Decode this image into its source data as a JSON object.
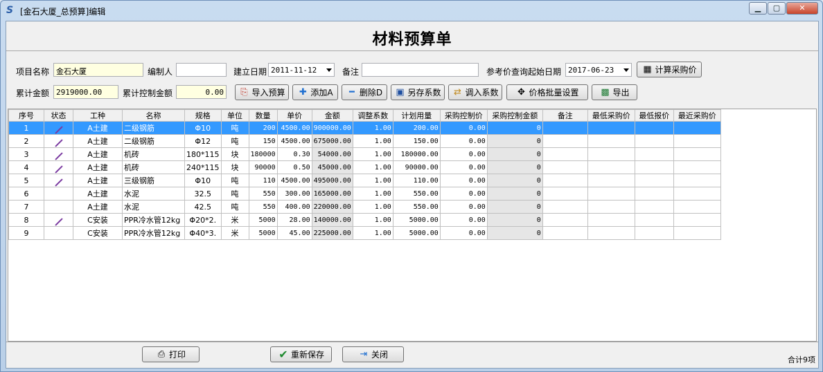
{
  "window": {
    "title": "[金石大厦_总预算]编辑"
  },
  "page_title": "材料预算单",
  "form": {
    "project_name_label": "项目名称",
    "project_name": "金石大厦",
    "editor_label": "编制人",
    "editor": "",
    "date_label": "建立日期",
    "date": "2011-11-12",
    "remark_label": "备注",
    "remark": "",
    "ref_date_label": "参考价查询起始日期",
    "ref_date": "2017-06-23",
    "calc_button": "计算采购价",
    "total_amount_label": "累计金额",
    "total_amount": "2919000.00",
    "control_amount_label": "累计控制金额",
    "control_amount": "0.00"
  },
  "toolbar": {
    "import": "导入预算",
    "add": "添加A",
    "delete": "删除D",
    "save_coef": "另存系数",
    "load_coef": "调入系数",
    "batch_price": "价格批量设置",
    "export": "导出"
  },
  "table": {
    "headers": [
      "序号",
      "状态",
      "工种",
      "名称",
      "规格",
      "单位",
      "数量",
      "单价",
      "金额",
      "调整系数",
      "计划用量",
      "采购控制价",
      "采购控制金额",
      "备注",
      "最低采购价",
      "最低报价",
      "最近采购价"
    ],
    "rows": [
      {
        "no": "1",
        "status": true,
        "type": "A土建",
        "name": "二级钢筋",
        "spec": "Φ10",
        "unit": "吨",
        "qty": "200",
        "price": "4500.00",
        "amount": "900000.00",
        "coef": "1.00",
        "plan": "200.00",
        "ctrl_price": "0.00",
        "ctrl_amount": "0"
      },
      {
        "no": "2",
        "status": true,
        "type": "A土建",
        "name": "二级钢筋",
        "spec": "Φ12",
        "unit": "吨",
        "qty": "150",
        "price": "4500.00",
        "amount": "675000.00",
        "coef": "1.00",
        "plan": "150.00",
        "ctrl_price": "0.00",
        "ctrl_amount": "0"
      },
      {
        "no": "3",
        "status": true,
        "type": "A土建",
        "name": "机砖",
        "spec": "180*115",
        "unit": "块",
        "qty": "180000",
        "price": "0.30",
        "amount": "54000.00",
        "coef": "1.00",
        "plan": "180000.00",
        "ctrl_price": "0.00",
        "ctrl_amount": "0"
      },
      {
        "no": "4",
        "status": true,
        "type": "A土建",
        "name": "机砖",
        "spec": "240*115",
        "unit": "块",
        "qty": "90000",
        "price": "0.50",
        "amount": "45000.00",
        "coef": "1.00",
        "plan": "90000.00",
        "ctrl_price": "0.00",
        "ctrl_amount": "0"
      },
      {
        "no": "5",
        "status": true,
        "type": "A土建",
        "name": "三级钢筋",
        "spec": "Φ10",
        "unit": "吨",
        "qty": "110",
        "price": "4500.00",
        "amount": "495000.00",
        "coef": "1.00",
        "plan": "110.00",
        "ctrl_price": "0.00",
        "ctrl_amount": "0"
      },
      {
        "no": "6",
        "status": false,
        "type": "A土建",
        "name": "水泥",
        "spec": "32.5",
        "unit": "吨",
        "qty": "550",
        "price": "300.00",
        "amount": "165000.00",
        "coef": "1.00",
        "plan": "550.00",
        "ctrl_price": "0.00",
        "ctrl_amount": "0"
      },
      {
        "no": "7",
        "status": false,
        "type": "A土建",
        "name": "水泥",
        "spec": "42.5",
        "unit": "吨",
        "qty": "550",
        "price": "400.00",
        "amount": "220000.00",
        "coef": "1.00",
        "plan": "550.00",
        "ctrl_price": "0.00",
        "ctrl_amount": "0"
      },
      {
        "no": "8",
        "status": true,
        "type": "C安装",
        "name": "PPR冷水管12kg",
        "spec": "Φ20*2.",
        "unit": "米",
        "qty": "5000",
        "price": "28.00",
        "amount": "140000.00",
        "coef": "1.00",
        "plan": "5000.00",
        "ctrl_price": "0.00",
        "ctrl_amount": "0"
      },
      {
        "no": "9",
        "status": false,
        "type": "C安装",
        "name": "PPR冷水管12kg",
        "spec": "Φ40*3.",
        "unit": "米",
        "qty": "5000",
        "price": "45.00",
        "amount": "225000.00",
        "coef": "1.00",
        "plan": "5000.00",
        "ctrl_price": "0.00",
        "ctrl_amount": "0"
      }
    ]
  },
  "footer": {
    "print": "打印",
    "resave": "重新保存",
    "close": "关闭",
    "total_count": "合计9项"
  }
}
